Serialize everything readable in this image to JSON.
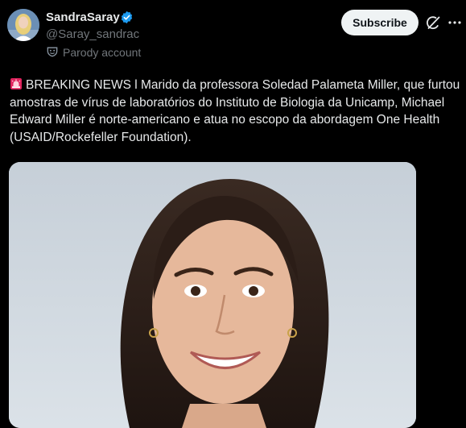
{
  "author": {
    "display_name": "SandraSaray",
    "handle": "@Saray_sandrac",
    "account_label": "Parody account",
    "verified_color": "#1d9bf0"
  },
  "actions": {
    "subscribe_label": "Subscribe"
  },
  "tweet": {
    "text": "BREAKING NEWS l Marido da professora Soledad Palameta Miller, que furtou amostras de vírus de laboratórios do Instituto de Biologia da Unicamp, Michael Edward Miller é norte-americano e atua no escopo da abordagem One Health (USAID/Rockefeller Foundation).",
    "leading_emoji": "siren-icon"
  },
  "icons": {
    "verified": "verified-badge-icon",
    "parody": "parody-mask-icon",
    "grok": "grok-icon",
    "more": "more-icon"
  },
  "colors": {
    "background": "#000000",
    "text": "#e7e9ea",
    "secondary_text": "#71767b",
    "subscribe_bg": "#eff3f4",
    "siren": "#e0245e"
  }
}
